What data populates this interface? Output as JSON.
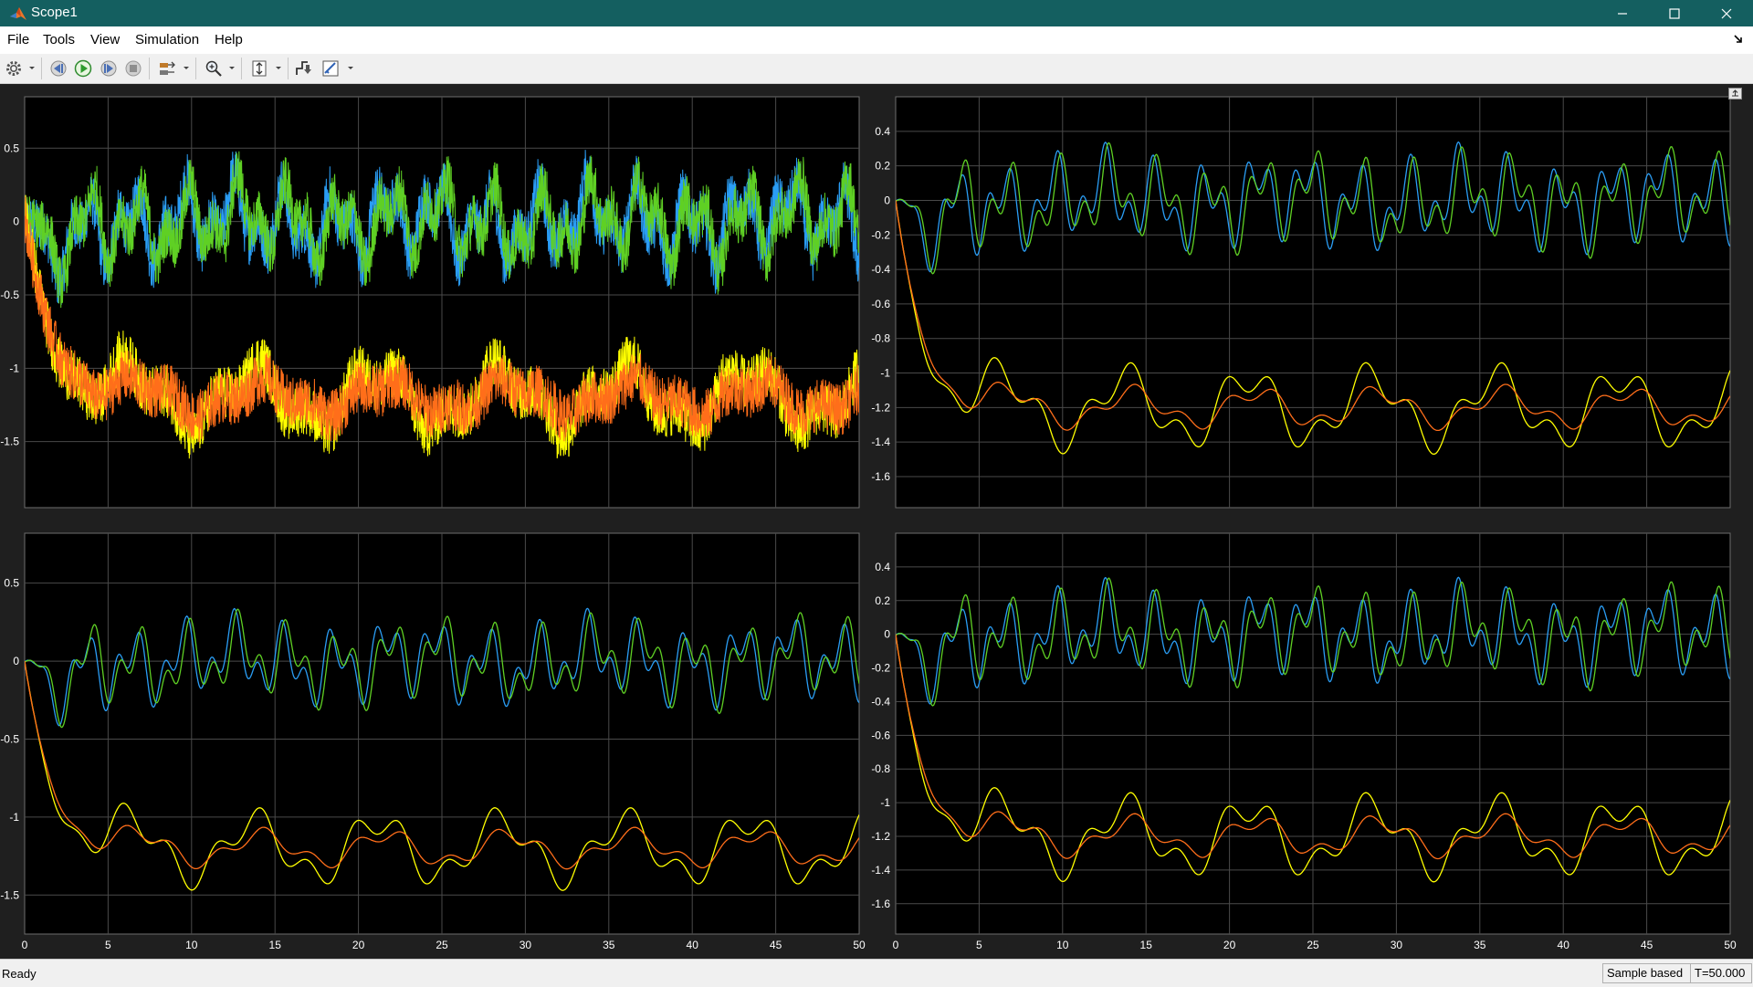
{
  "window": {
    "title": "Scope1",
    "app_icon": "matlab-icon",
    "controls": [
      "minimize-icon",
      "maximize-icon",
      "close-icon"
    ],
    "titlebar_color": "#145f60"
  },
  "menu": {
    "items": [
      "File",
      "Tools",
      "View",
      "Simulation",
      "Help"
    ],
    "dock_icon": "dock-arrow-icon"
  },
  "toolbar": {
    "buttons": [
      "settings-gear-icon",
      "step-back-icon",
      "run-icon",
      "step-forward-icon",
      "stop-icon",
      "signal-routing-icon",
      "zoom-in-icon",
      "scale-axes-icon",
      "triggers-icon",
      "cursor-measurements-icon"
    ]
  },
  "status": {
    "text": "Ready",
    "mode": "Sample based",
    "time": "T=50.000"
  },
  "plot_style": {
    "background": "#000000",
    "grid": "#4a4a4a",
    "axis_text": "#ffffff",
    "colors": {
      "blue": "#2a9df4",
      "green": "#5fd024",
      "yellow": "#ffff00",
      "orange": "#ff6e1a"
    }
  },
  "chart_data": [
    {
      "type": "line",
      "position": "top-left",
      "xlim": [
        0,
        50
      ],
      "ylim": [
        -1.95,
        0.85
      ],
      "xticks": [
        0,
        5,
        10,
        15,
        20,
        25,
        30,
        35,
        40,
        45,
        50
      ],
      "yticks": [
        -1.5,
        -1,
        -0.5,
        0,
        0.5
      ],
      "ytick_labels": [
        "-1.5",
        "-1",
        "-0.5",
        "0",
        "0.5"
      ],
      "xtick_labels": [],
      "grid": true,
      "noise": 0.18,
      "series": [
        {
          "color": "blue",
          "kind": "osc",
          "phase": 0.7,
          "start": 0
        },
        {
          "color": "green",
          "kind": "osc",
          "phase": 0,
          "start": 0
        },
        {
          "color": "yellow",
          "kind": "decay",
          "phase": 0.4,
          "start": 0.1
        },
        {
          "color": "orange",
          "kind": "decay",
          "phase": 0,
          "start": 0.05
        }
      ]
    },
    {
      "type": "line",
      "position": "top-right",
      "xlim": [
        0,
        50
      ],
      "ylim": [
        -1.78,
        0.6
      ],
      "xticks": [
        0,
        5,
        10,
        15,
        20,
        25,
        30,
        35,
        40,
        45,
        50
      ],
      "yticks": [
        -1.6,
        -1.4,
        -1.2,
        -1,
        -0.8,
        -0.6,
        -0.4,
        -0.2,
        0,
        0.2,
        0.4
      ],
      "ytick_labels": [
        "-1.6",
        "-1.4",
        "-1.2",
        "-1",
        "-0.8",
        "-0.6",
        "-0.4",
        "-0.2",
        "0",
        "0.2",
        "0.4"
      ],
      "xtick_labels": [],
      "grid": true,
      "noise": 0,
      "series": [
        {
          "color": "blue",
          "kind": "osc",
          "phase": 0.7,
          "start": 0
        },
        {
          "color": "green",
          "kind": "osc",
          "phase": 0,
          "start": 0
        },
        {
          "color": "yellow",
          "kind": "decay",
          "phase": 0.4,
          "start": 0
        },
        {
          "color": "orange",
          "kind": "decay",
          "phase": 0,
          "start": 0
        }
      ]
    },
    {
      "type": "line",
      "position": "bottom-left",
      "xlim": [
        0,
        50
      ],
      "ylim": [
        -1.75,
        0.82
      ],
      "xticks": [
        0,
        5,
        10,
        15,
        20,
        25,
        30,
        35,
        40,
        45,
        50
      ],
      "yticks": [
        -1.5,
        -1,
        -0.5,
        0,
        0.5
      ],
      "ytick_labels": [
        "-1.5",
        "-1",
        "-0.5",
        "0",
        "0.5"
      ],
      "xtick_labels": [
        "0",
        "5",
        "10",
        "15",
        "20",
        "25",
        "30",
        "35",
        "40",
        "45",
        "50"
      ],
      "grid": true,
      "noise": 0,
      "series": [
        {
          "color": "blue",
          "kind": "osc",
          "phase": 0.7,
          "start": 0
        },
        {
          "color": "green",
          "kind": "osc",
          "phase": 0,
          "start": 0
        },
        {
          "color": "yellow",
          "kind": "decay",
          "phase": 0.4,
          "start": 0
        },
        {
          "color": "orange",
          "kind": "decay",
          "phase": 0,
          "start": 0
        }
      ]
    },
    {
      "type": "line",
      "position": "bottom-right",
      "xlim": [
        0,
        50
      ],
      "ylim": [
        -1.78,
        0.6
      ],
      "xticks": [
        0,
        5,
        10,
        15,
        20,
        25,
        30,
        35,
        40,
        45,
        50
      ],
      "yticks": [
        -1.6,
        -1.4,
        -1.2,
        -1,
        -0.8,
        -0.6,
        -0.4,
        -0.2,
        0,
        0.2,
        0.4
      ],
      "ytick_labels": [
        "-1.6",
        "-1.4",
        "-1.2",
        "-1",
        "-0.8",
        "-0.6",
        "-0.4",
        "-0.2",
        "0",
        "0.2",
        "0.4"
      ],
      "xtick_labels": [
        "0",
        "5",
        "10",
        "15",
        "20",
        "25",
        "30",
        "35",
        "40",
        "45",
        "50"
      ],
      "grid": true,
      "noise": 0,
      "series": [
        {
          "color": "blue",
          "kind": "osc",
          "phase": 0.7,
          "start": 0
        },
        {
          "color": "green",
          "kind": "osc",
          "phase": 0,
          "start": 0
        },
        {
          "color": "yellow",
          "kind": "decay",
          "phase": 0.4,
          "start": 0
        },
        {
          "color": "orange",
          "kind": "decay",
          "phase": 0,
          "start": 0
        }
      ]
    }
  ]
}
